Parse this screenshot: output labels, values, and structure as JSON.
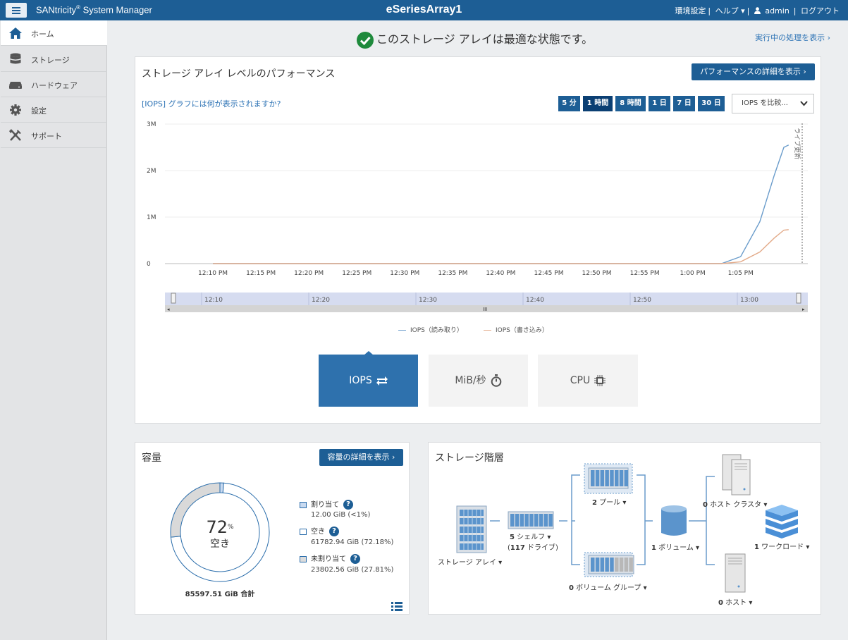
{
  "header": {
    "brand_prefix": "SANtricity",
    "brand_reg": "®",
    "brand_suffix": " System Manager",
    "array_name": "eSeriesArray1",
    "preferences": "環境設定",
    "help": "ヘルプ ▾",
    "user": "admin",
    "logout": "ログアウト"
  },
  "sidebar": {
    "items": [
      {
        "label": "ホーム",
        "icon": "home-icon",
        "active": true
      },
      {
        "label": "ストレージ",
        "icon": "storage-icon",
        "active": false
      },
      {
        "label": "ハードウェア",
        "icon": "hardware-icon",
        "active": false
      },
      {
        "label": "設定",
        "icon": "gear-icon",
        "active": false
      },
      {
        "label": "サポート",
        "icon": "tools-icon",
        "active": false
      }
    ]
  },
  "status": {
    "text": "このストレージ アレイは最適な状態です。",
    "pending_link": "実行中の処理を表示 ›"
  },
  "performance": {
    "title": "ストレージ アレイ レベルのパフォーマンス",
    "detail_button": "パフォーマンスの詳細を表示 ›",
    "help_link": "[IOPS] グラフには何が表示されますか?",
    "time_buttons": [
      "5 分",
      "1 時間",
      "8 時間",
      "1 日",
      "7 日",
      "30 日"
    ],
    "selected_time": "1 時間",
    "compare_select": "IOPS を比較...",
    "live_update_label": "ライブ更新",
    "metric_buttons": [
      {
        "label": "IOPS",
        "icon": "swap-arrows-icon",
        "active": true
      },
      {
        "label": "MiB/秒",
        "icon": "stopwatch-icon",
        "active": false
      },
      {
        "label": "CPU",
        "icon": "chip-icon",
        "active": false
      }
    ],
    "navigator_ticks": [
      "12:10",
      "12:20",
      "12:30",
      "12:40",
      "12:50",
      "13:00"
    ],
    "colors": {
      "read": "#6a9ccb",
      "write": "#e3ab8a"
    }
  },
  "chart_data": {
    "type": "line",
    "title": "",
    "xlabel": "",
    "ylabel": "",
    "y_ticks": [
      "3M",
      "2M",
      "1M",
      "0"
    ],
    "x_ticks": [
      "12:10 PM",
      "12:15 PM",
      "12:20 PM",
      "12:25 PM",
      "12:30 PM",
      "12:35 PM",
      "12:40 PM",
      "12:45 PM",
      "12:50 PM",
      "12:55 PM",
      "1:00 PM",
      "1:05 PM"
    ],
    "ylim": [
      0,
      3000000
    ],
    "grid": true,
    "legend_position": "bottom",
    "x_minutes": [
      5,
      55,
      58,
      60,
      62,
      63.5,
      64.5,
      65
    ],
    "series": [
      {
        "name": "IOPS（読み取り）",
        "color": "#6a9ccb",
        "values": [
          0,
          0,
          0,
          150000,
          900000,
          1900000,
          2500000,
          2550000
        ]
      },
      {
        "name": "IOPS（書き込み）",
        "color": "#e3ab8a",
        "values": [
          0,
          0,
          0,
          40000,
          250000,
          550000,
          720000,
          730000
        ]
      }
    ]
  },
  "capacity": {
    "title": "容量",
    "detail_button": "容量の詳細を表示 ›",
    "free_percent": 72,
    "percent_sign": "%",
    "free_label": "空き",
    "total": "85597.51 GiB 合計",
    "allocated_fraction": 0.0001,
    "free_fraction": 0.7218,
    "unassigned_fraction": 0.2781,
    "legend": [
      {
        "label": "割り当て",
        "value": "12.00 GiB (<1%)",
        "color": "#c9daf0"
      },
      {
        "label": "空き",
        "value": "61782.94 GiB (72.18%)",
        "color": "#ffffff"
      },
      {
        "label": "未割り当て",
        "value": "23802.56 GiB (27.81%)",
        "color": "#dcdcdc"
      }
    ],
    "help_glyph": "?",
    "colors": {
      "free": "#ffffff",
      "unassigned": "#d9d9d9",
      "allocated": "#c9daf0",
      "border": "#2a6dab"
    }
  },
  "hierarchy": {
    "title": "ストレージ階層",
    "storage_array": "ストレージ アレイ",
    "shelves_count": "5",
    "shelves": "シェルフ",
    "drives_count": "117",
    "drives": "ドライブ",
    "pools_count": "2",
    "pools": "プール",
    "volume_groups_count": "0",
    "volume_groups": "ボリューム グループ",
    "volumes_count": "1",
    "volumes": "ボリューム",
    "host_clusters_count": "0",
    "host_clusters": "ホスト クラスタ",
    "workloads_count": "1",
    "workloads": "ワークロード",
    "hosts_count": "0",
    "hosts": "ホスト",
    "caret": "▾"
  }
}
